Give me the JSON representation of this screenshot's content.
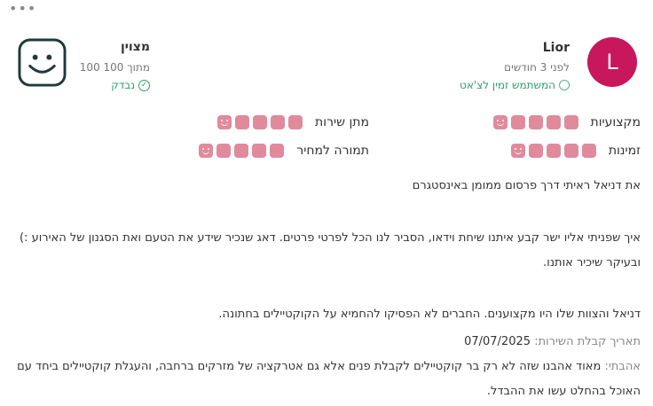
{
  "colors": {
    "avatar_bg": "#c8175a",
    "accent_green": "#2e9e6a",
    "rating_pink": "#e08a9c",
    "smiley_stroke": "#1e3a3a"
  },
  "icons": {
    "more": "more-horizontal-icon",
    "chat": "whatsapp-chat-icon",
    "check": "verified-check-icon",
    "smiley": "smiley-face-icon"
  },
  "reviewer": {
    "initial": "L",
    "name": "Lior",
    "time": "לפני 3 חודשים",
    "whatsapp_note": "המשתמש זמין לצ'אט"
  },
  "score": {
    "label": "מצוין",
    "text": "100 מתוך 100",
    "verified": "נבדק"
  },
  "ratings": [
    {
      "label": "מקצועיות",
      "value": 5,
      "max": 5
    },
    {
      "label": "מתן שירות",
      "value": 5,
      "max": 5
    },
    {
      "label": "זמינות",
      "value": 5,
      "max": 5
    },
    {
      "label": "תמורה למחיר",
      "value": 5,
      "max": 5
    }
  ],
  "review": {
    "line1": "את דניאל ראיתי דרך פרסום ממומן באינסטגרם",
    "line2": "איך שפניתי אליו ישר קבע איתנו שיחת וידאו, הסביר לנו הכל לפרטי פרטים. דאג שנכיר שידע את הטעם ואת הסגנון של האירוע :) ובעיקר שיכיר אותנו.",
    "line3": "דניאל והצוות שלו היו מקצוענים. החברים לא הפסיקו להחמיא על הקוקטיילים בחתונה.",
    "date_label": "תאריך קבלת השירות:",
    "date_value": "07/07/2025",
    "liked_label": "אהבתי:",
    "liked_text": "מאוד אהבנו שזה לא רק בר קוקטיילים לקבלת פנים אלא גם אטרקציה של מזרקים ברחבה, והעגלת קוקטיילים ביחד עם האוכל בהחלט עשו את ההבדל."
  }
}
